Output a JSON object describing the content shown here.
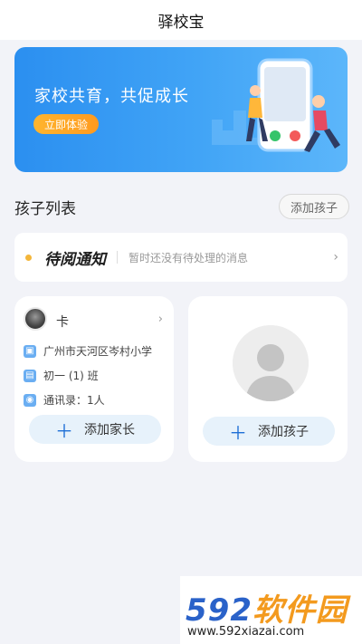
{
  "header": {
    "title": "驿校宝"
  },
  "banner": {
    "headline": "家校共育，共促成长",
    "cta": "立即体验"
  },
  "children": {
    "section_title": "孩子列表",
    "add_child_label": "添加孩子"
  },
  "notice": {
    "title": "待阅通知",
    "message": "暂时还没有待处理的消息"
  },
  "child_card": {
    "name": "卡",
    "school": "广州市天河区岑村小学",
    "class": "初一 (1) 班",
    "contacts": "通讯录：1人",
    "add_parent_label": "添加家长"
  },
  "empty_card": {
    "add_child_label": "添加孩子"
  },
  "watermark": {
    "brand_prefix": "592",
    "brand_suffix": "软件园",
    "url": "www.592xiazai.com"
  }
}
